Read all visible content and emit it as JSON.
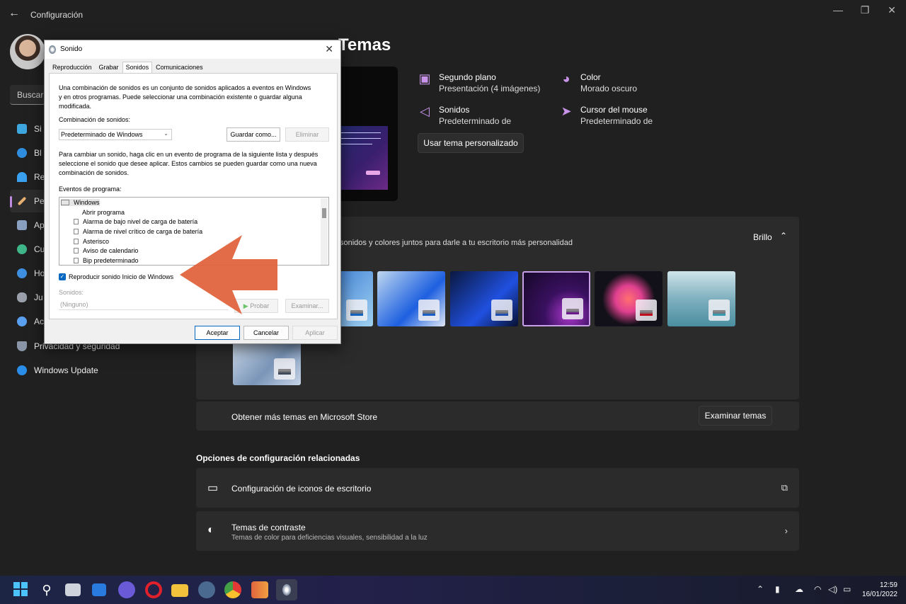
{
  "app": {
    "title": "Configuración",
    "back_icon": "←",
    "minimize": "—",
    "maximize": "❐",
    "close": "✕"
  },
  "sidebar": {
    "search_placeholder": "Buscar",
    "items": [
      {
        "label": "Si",
        "icon_color": "#3fa7e0"
      },
      {
        "label": "Bl",
        "icon_color": "#2f8ee0"
      },
      {
        "label": "Re",
        "icon_color": "#3aa0f0"
      },
      {
        "label": "Pe",
        "icon_color": "#e8b070",
        "active": true
      },
      {
        "label": "Ap",
        "icon_color": "#8aa0c0"
      },
      {
        "label": "Cu",
        "icon_color": "#3fb58a"
      },
      {
        "label": "Ho",
        "icon_color": "#3f8fe0"
      },
      {
        "label": "Ju",
        "icon_color": "#9aa0aa"
      },
      {
        "label": "Ac",
        "icon_color": "#5aa0f0"
      },
      {
        "label": "Privacidad y seguridad",
        "icon_color": "#8a96a8"
      },
      {
        "label": "Windows Update",
        "icon_color": "#2a8ee8"
      }
    ]
  },
  "page": {
    "title": "Temas",
    "background_label": "Segundo plano",
    "background_value": "Presentación (4 imágenes)",
    "color_label": "Color",
    "color_value": "Morado oscuro",
    "sounds_label": "Sonidos",
    "sounds_value": "Predeterminado de",
    "cursor_label": "Cursor del mouse",
    "cursor_value": "Predeterminado de",
    "use_custom_theme": "Usar tema personalizado",
    "themes_description": "sonidos y colores juntos para darle a tu escritorio más personalidad",
    "brightness_label": "Brillo",
    "store_text": "Obtener más temas en Microsoft Store",
    "browse_themes": "Examinar temas",
    "related_heading": "Opciones de configuración relacionadas",
    "desktop_icons": "Configuración de iconos de escritorio",
    "contrast_title": "Temas de contraste",
    "contrast_sub": "Temas de color para deficiencias visuales, sensibilidad a la luz"
  },
  "themes": [
    {
      "bg": "linear-gradient(135deg,#2a6fd0,#9fd0f0)",
      "accent": "#1565c0"
    },
    {
      "bg": "linear-gradient(135deg,#bfd8f0,#1d5fe0 60%,#dfe8f5)",
      "accent": "#1a5fc8"
    },
    {
      "bg": "linear-gradient(135deg,#0a1840,#2050e0 60%,#081030)",
      "accent": "#1f4fb0"
    },
    {
      "bg": "radial-gradient(circle at 70% 80%,#b03ad0,#3a1060 40%,#160828)",
      "accent": "#6a1a8a",
      "selected": true
    },
    {
      "bg": "radial-gradient(circle at 50% 50%,#ff7070,#e04090 30%,#121018 60%)",
      "accent": "#c01020"
    },
    {
      "bg": "linear-gradient(180deg,#cfe4ea,#7fb0bf 50%,#4a8ea0)",
      "accent": "#3a9ab0"
    },
    {
      "bg": "linear-gradient(135deg,#dbe6f2,#7a95b8 60%,#c6d4e6)",
      "accent": "#404a58"
    }
  ],
  "dialog": {
    "title": "Sonido",
    "tabs": [
      "Reproducción",
      "Grabar",
      "Sonidos",
      "Comunicaciones"
    ],
    "intro": "Una combinación de sonidos es un conjunto de sonidos aplicados a eventos en Windows y en otros programas. Puede seleccionar una combinación existente o guardar alguna modificada.",
    "scheme_label": "Combinación de sonidos:",
    "scheme_value": "Predeterminado de Windows",
    "save_as": "Guardar como...",
    "delete": "Eliminar",
    "change_text": "Para cambiar un sonido, haga clic en un evento de programa de la siguiente lista y después seleccione el sonido que desee aplicar. Estos cambios se pueden guardar como una nueva combinación de sonidos.",
    "events_label": "Eventos de programa:",
    "events": [
      "Windows",
      "Abrir programa",
      "Alarma de bajo nivel de carga de batería",
      "Alarma de nivel crítico de carga de batería",
      "Asterisco",
      "Aviso de calendario",
      "Bip predeterminado"
    ],
    "startup_checkbox": "Reproducir sonido Inicio de Windows",
    "sounds_label": "Sonidos:",
    "sound_value": "(Ninguno)",
    "test": "Probar",
    "browse": "Examinar...",
    "ok": "Aceptar",
    "cancel": "Cancelar",
    "apply": "Aplicar"
  },
  "taskbar": {
    "time": "12:59",
    "date": "16/01/2022"
  }
}
